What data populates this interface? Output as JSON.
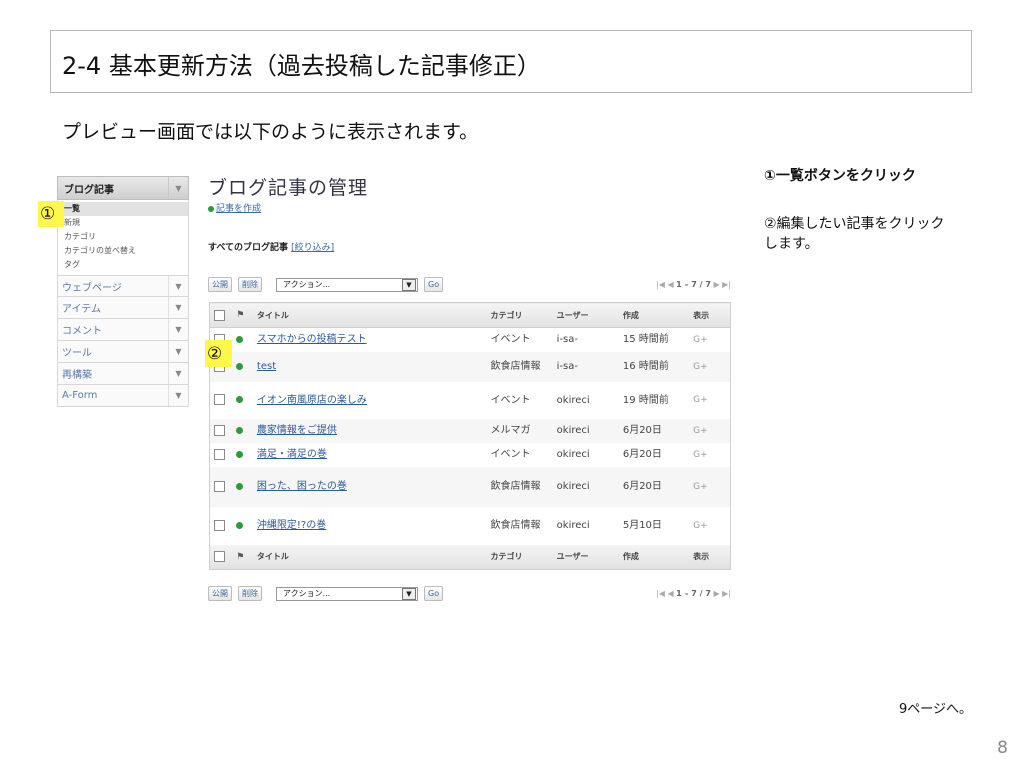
{
  "slide": {
    "title": "2-4 基本更新方法（過去投稿した記事修正）",
    "subtitle": "プレビュー画面では以下のように表示されます。",
    "note1": "①一覧ボタンをクリック",
    "note2_line1": "②編集したい記事をクリック",
    "note2_line2": "します。",
    "next_page": "9ページへ。",
    "page_number": "8",
    "marker1": "①",
    "marker2": "②"
  },
  "sidebar": {
    "header": "ブログ記事",
    "subitems": [
      "一覧",
      "新規",
      "カテゴリ",
      "カテゴリの並べ替え",
      "タグ"
    ],
    "items": [
      "ウェブページ",
      "アイテム",
      "コメント",
      "ツール",
      "再構築",
      "A-Form"
    ]
  },
  "main": {
    "heading": "ブログ記事の管理",
    "create_link": "記事を作成",
    "all_posts_label": "すべてのブログ記事",
    "filter_link": "[絞り込み]",
    "publish_button": "公開",
    "delete_button": "削除",
    "action_select": "アクション...",
    "go_button": "Go",
    "pager_prefix": "|◀ ◀",
    "pager_range": "1 – 7 / 7",
    "pager_suffix": "▶ ▶|"
  },
  "table": {
    "columns": {
      "flag": "⚑",
      "title": "タイトル",
      "category": "カテゴリ",
      "user": "ユーザー",
      "created": "作成",
      "view": "表示"
    },
    "rows": [
      {
        "title": "スマホからの投稿テスト",
        "category": "イベント",
        "user": "i-sa-",
        "created": "15 時間前",
        "view": "G+"
      },
      {
        "title": "test",
        "category": "飲食店情報",
        "user": "i-sa-",
        "created": "16 時間前",
        "view": "G+"
      },
      {
        "title": "イオン南風原店の楽しみ",
        "category": "イベント",
        "user": "okireci",
        "created": "19 時間前",
        "view": "G+"
      },
      {
        "title": "農家情報をご提供",
        "category": "メルマガ",
        "user": "okireci",
        "created": "6月20日",
        "view": "G+"
      },
      {
        "title": "満足・満足の巻",
        "category": "イベント",
        "user": "okireci",
        "created": "6月20日",
        "view": "G+"
      },
      {
        "title": "困った、困ったの巻",
        "category": "飲食店情報",
        "user": "okireci",
        "created": "6月20日",
        "view": "G+"
      },
      {
        "title": "沖縄限定!?の巻",
        "category": "飲食店情報",
        "user": "okireci",
        "created": "5月10日",
        "view": "G+"
      }
    ]
  }
}
